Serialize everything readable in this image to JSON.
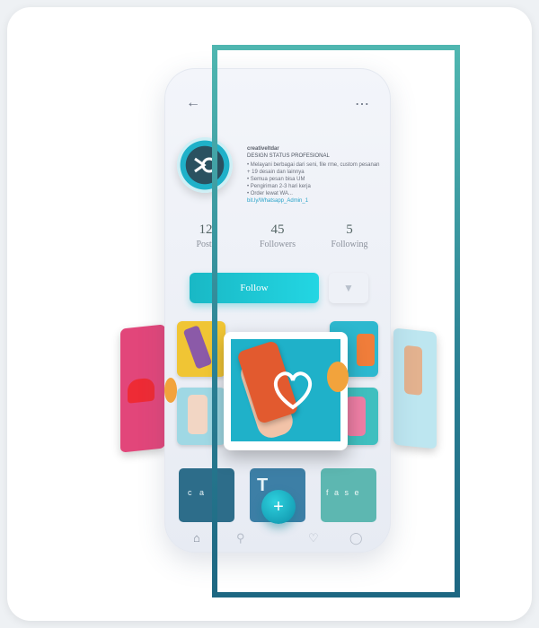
{
  "profile": {
    "username": "creativeltdar",
    "title": "DESIGN STATUS PROFESIONAL",
    "bio_lines": [
      "• Melayani berbagai dari seni, file rme, custom pesanan + 19 desain dan lainnya",
      "• Semua pesan bisa UM",
      "• Pengiriman 2-3 hari kerja",
      "• Order lewat WA..."
    ],
    "link": "bit.ly/Whatsapp_Admin_1"
  },
  "stats": [
    {
      "value": "12",
      "label": "Posts"
    },
    {
      "value": "45",
      "label": "Followers"
    },
    {
      "value": "5",
      "label": "Following"
    }
  ],
  "actions": {
    "follow_label": "Follow",
    "dropdown_icon": "chevron-down-icon"
  },
  "grid_colors": [
    "#f0c534",
    "#2db8cf",
    "#f07d3a",
    "#1fb1c9",
    "#9fd8e4",
    "#3fbfbf"
  ],
  "bottom_row_colors": [
    "#2d6d8a",
    "#3d7fa6",
    "#5db7b1"
  ],
  "bottom_row_texts": [
    "c a n",
    "T",
    "f a s e"
  ],
  "nav": {
    "icons": [
      "home-icon",
      "search-icon",
      "add-icon",
      "heart-icon",
      "profile-icon"
    ]
  },
  "colors": {
    "accent": "#1fb8c6",
    "frame": "#3aa3a6"
  }
}
